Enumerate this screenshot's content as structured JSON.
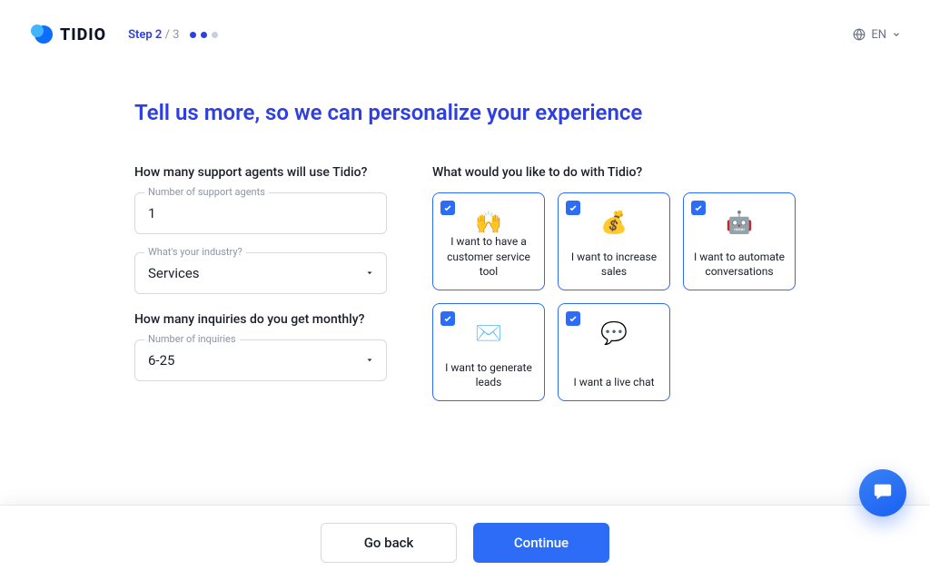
{
  "brand": {
    "name": "TIDIO"
  },
  "progress": {
    "current_label": "Step 2",
    "divider": " / ",
    "total": "3"
  },
  "language": {
    "code": "EN"
  },
  "page_title": "Tell us more, so we can personalize your experience",
  "left": {
    "q1_label": "How many support agents will use Tidio?",
    "agents_field": {
      "label": "Number of support agents",
      "value": "1"
    },
    "industry_field": {
      "label": "What's your industry?",
      "value": "Services"
    },
    "q2_label": "How many inquiries do you get monthly?",
    "inquiries_field": {
      "label": "Number of inquiries",
      "value": "6-25"
    }
  },
  "right": {
    "q_label": "What would you like to do with Tidio?",
    "cards": [
      {
        "emoji": "🙌",
        "label": "I want to have a customer service tool"
      },
      {
        "emoji": "💰",
        "label": "I want to increase sales"
      },
      {
        "emoji": "🤖",
        "label": "I want to automate conversations"
      },
      {
        "emoji": "✉️",
        "label": "I want to generate leads"
      },
      {
        "emoji": "💬",
        "label": "I want a live chat"
      }
    ]
  },
  "footer": {
    "back_label": "Go back",
    "continue_label": "Continue"
  }
}
